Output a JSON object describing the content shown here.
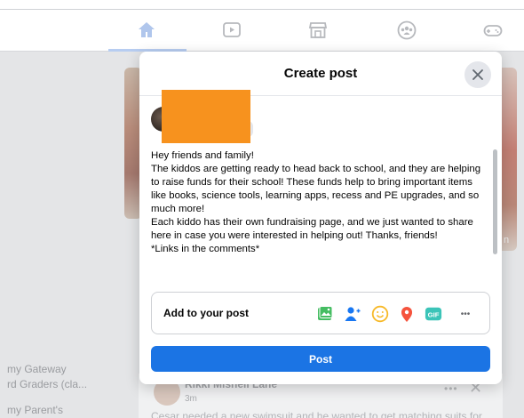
{
  "background": {
    "sidebar_items": [
      "my Gateway",
      "rd Graders (cla...",
      "my Parent's"
    ],
    "story_right_partial": "n",
    "feed_post": {
      "author": "Rikki Misheli Lane",
      "time": "3m",
      "body_preview": "Cesar needed a new swimsuit and he wanted to get matching suits for"
    }
  },
  "nav": {
    "tabs": [
      {
        "name": "home",
        "active": true
      },
      {
        "name": "watch",
        "active": false
      },
      {
        "name": "marketplace",
        "active": false
      },
      {
        "name": "groups",
        "active": false
      },
      {
        "name": "gaming",
        "active": false
      }
    ]
  },
  "modal": {
    "title": "Create post",
    "post_text": "Hey friends and family!\nThe kiddos are getting ready to head back to school, and they are helping to raise funds for their school! These funds help to bring important items like books, science tools, learning apps, recess and PE upgrades, and so much more!\nEach kiddo has their own fundraising page, and we just wanted to share here in case you were interested in helping out! Thanks, friends!\n*Links in the comments*",
    "add_to_post_label": "Add to your post",
    "add_icons": [
      "photo-video-icon",
      "tag-people-icon",
      "feeling-icon",
      "check-in-icon",
      "gif-icon",
      "more-icon"
    ],
    "gif_label": "GIF",
    "more_label": "•••",
    "post_button": "Post"
  },
  "colors": {
    "accent": "#1b74e4",
    "photo": "#45bd62",
    "tag": "#1877f2",
    "feeling": "#f7b928",
    "checkin": "#f5533d",
    "gif": "#3bc4b8",
    "redaction": "#f7921e"
  }
}
